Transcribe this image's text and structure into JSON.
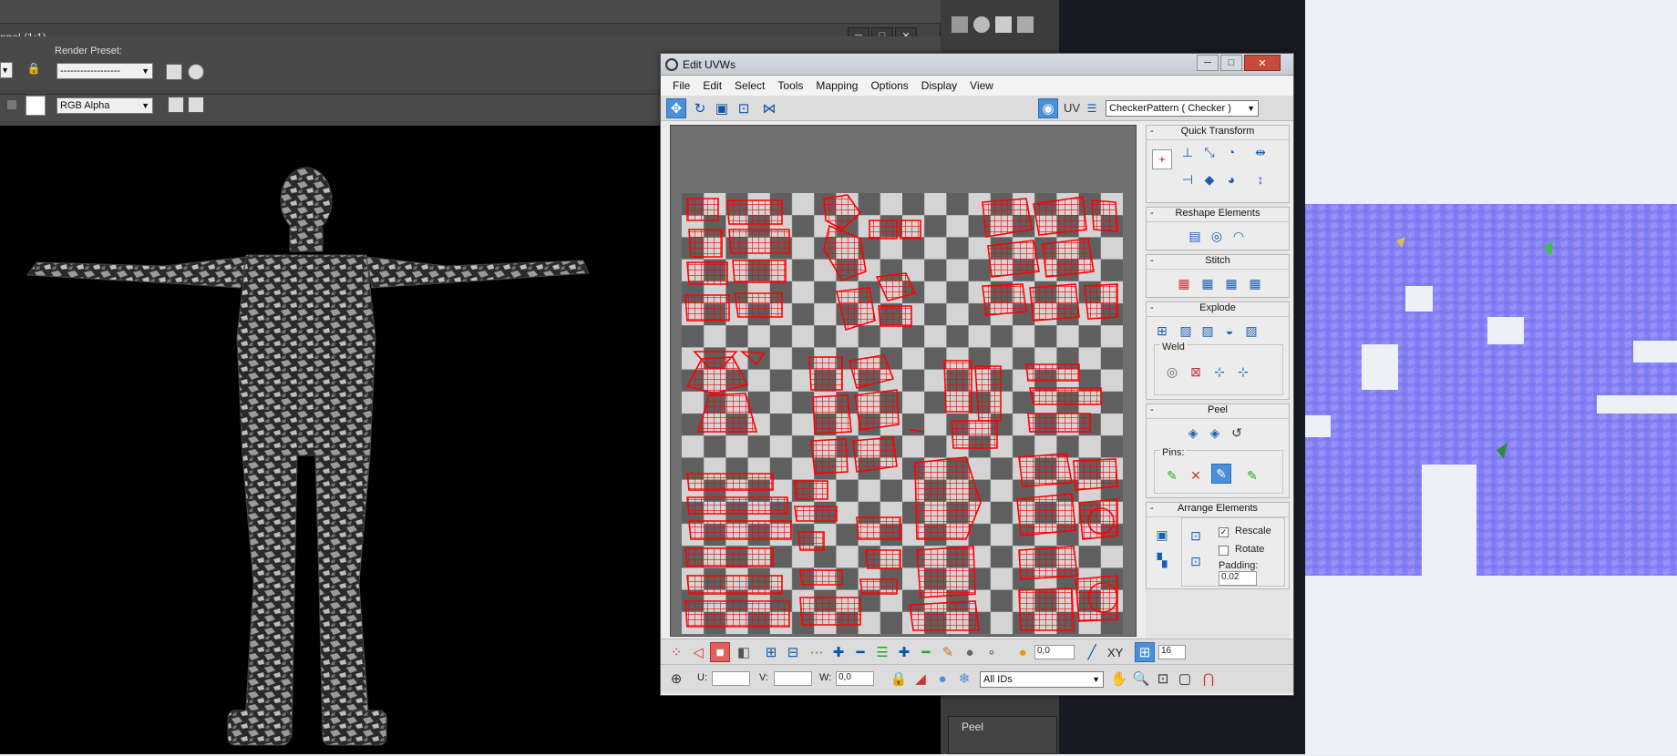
{
  "render_window": {
    "title": "nnel (1:1)",
    "render_preset_label": "Render Preset:",
    "render_preset_value": "------------------",
    "channel_value": "RGB Alpha",
    "titlebar_buttons": [
      "─",
      "□",
      "✕"
    ]
  },
  "uv_window": {
    "title": "Edit UVWs",
    "menu": [
      "File",
      "Edit",
      "Select",
      "Tools",
      "Mapping",
      "Options",
      "Display",
      "View"
    ],
    "uv_label": "UV",
    "texture_select": "CheckerPattern  ( Checker )",
    "titlebar_buttons": [
      "─",
      "□",
      "✕"
    ]
  },
  "rollouts": {
    "quick_transform": "Quick Transform",
    "reshape": "Reshape Elements",
    "stitch": "Stitch",
    "explode": "Explode",
    "weld": "Weld",
    "peel": "Peel",
    "pins": "Pins:",
    "arrange": "Arrange Elements",
    "rescale": "Rescale",
    "rotate": "Rotate",
    "padding_label": "Padding:",
    "padding_value": "0,02",
    "collapse": "-"
  },
  "bottom": {
    "soft_value": "0,0",
    "grid_value": "16",
    "u_label": "U:",
    "v_label": "V:",
    "w_label": "W:",
    "w_value": "0,0",
    "ids_select": "All IDs",
    "xy_label": "XY"
  },
  "bg_peel_label": "Peel",
  "colors": {
    "uv_wire": "#ff0000",
    "checker_dark": "#5f5f5f",
    "checker_light": "#d4d4d4",
    "active_tool": "#4a8fd8"
  }
}
